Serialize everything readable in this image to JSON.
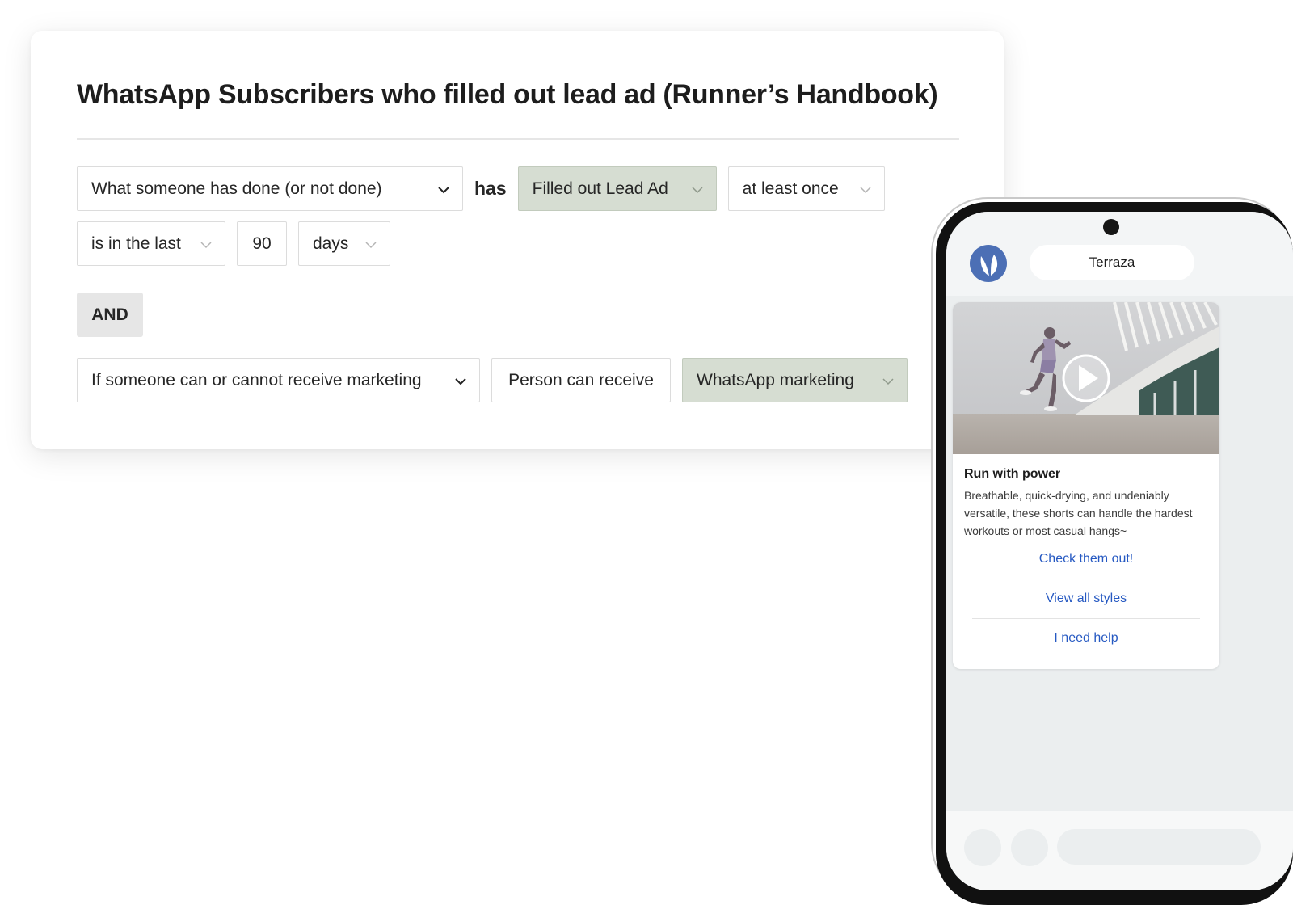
{
  "segment": {
    "title": "WhatsApp Subscribers who filled out lead ad (Runner’s Handbook)",
    "condition_1": {
      "type_select": "What someone has done (or not done)",
      "connector": "has",
      "event_select": "Filled out Lead Ad",
      "frequency_select": "at least once",
      "time_select": "is in the last",
      "amount": "90",
      "unit_select": "days"
    },
    "operator": "AND",
    "condition_2": {
      "type_select": "If someone can or cannot receive marketing",
      "status": "Person can receive",
      "channel_select": "WhatsApp marketing"
    }
  },
  "colors": {
    "selected_chip": "#d6ddd2",
    "and_chip": "#e6e6e6",
    "link": "#2659c2",
    "brand_logo": "#4c6fb5"
  },
  "phone": {
    "brand_name": "Terraza",
    "message": {
      "title": "Run with power",
      "body": "Breathable, quick-drying, and undeniably versatile, these shorts can handle the hardest workouts or most casual hangs~",
      "buttons": [
        "Check them out!",
        "View all styles",
        "I need help"
      ]
    }
  },
  "icons": [
    "chevron-down-icon",
    "play-icon",
    "brand-logo-icon",
    "camera-dot"
  ]
}
